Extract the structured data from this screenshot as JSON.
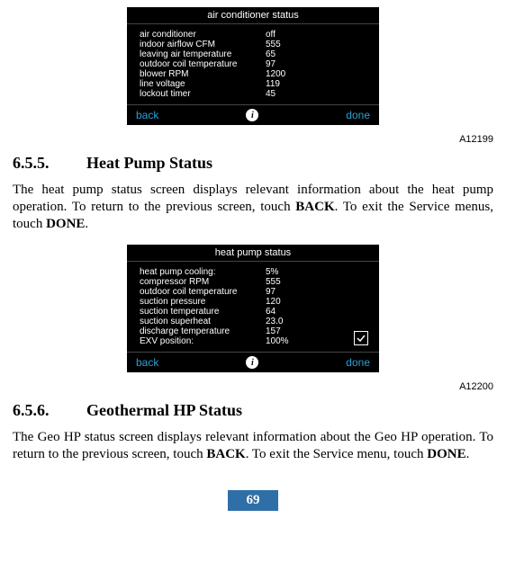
{
  "panel1": {
    "title": "air conditioner status",
    "rows": [
      {
        "label": "air conditioner",
        "value": "off"
      },
      {
        "label": "indoor airflow CFM",
        "value": "555"
      },
      {
        "label": "leaving air temperature",
        "value": "65"
      },
      {
        "label": "outdoor coil temperature",
        "value": "97"
      },
      {
        "label": "blower RPM",
        "value": "1200"
      },
      {
        "label": "line voltage",
        "value": "119"
      },
      {
        "label": "lockout timer",
        "value": "45"
      }
    ],
    "back": "back",
    "done": "done",
    "info": "i"
  },
  "caption1": "A12199",
  "section655": {
    "num": "6.5.5.",
    "title": "Heat Pump Status",
    "para_a": "The heat pump status screen displays relevant information about the heat pump operation. To return to the previous screen, touch ",
    "kw1": "BACK",
    "para_b": ". To exit the Service menus, touch ",
    "kw2": "DONE",
    "para_c": "."
  },
  "panel2": {
    "title": "heat pump status",
    "rows": [
      {
        "label": "heat pump cooling:",
        "value": "5%"
      },
      {
        "label": "compressor RPM",
        "value": "555"
      },
      {
        "label": "outdoor coil temperature",
        "value": "97"
      },
      {
        "label": "suction pressure",
        "value": "120"
      },
      {
        "label": "suction temperature",
        "value": "64"
      },
      {
        "label": "suction superheat",
        "value": "23.0"
      },
      {
        "label": "discharge temperature",
        "value": "157"
      },
      {
        "label": "EXV position:",
        "value": "100%"
      }
    ],
    "back": "back",
    "done": "done",
    "info": "i"
  },
  "caption2": "A12200",
  "section656": {
    "num": "6.5.6.",
    "title": "Geothermal HP Status",
    "para_a": "The Geo HP status screen displays relevant information about the Geo HP operation. To return to the previous screen, touch ",
    "kw1": "BACK",
    "para_b": ". To exit the Service menu, touch ",
    "kw2": "DONE",
    "para_c": "."
  },
  "pageNum": "69"
}
